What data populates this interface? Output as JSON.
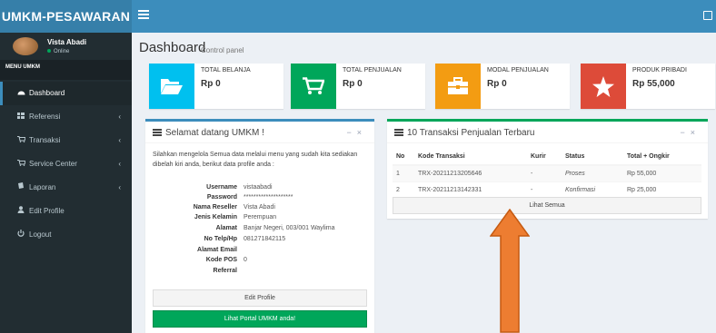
{
  "header": {
    "brand": "UMKM-PESAWARAN"
  },
  "sidebar": {
    "user": {
      "name": "Vista Abadi",
      "status": "Online"
    },
    "menu_header": "MENU UMKM",
    "items": [
      {
        "label": "Dashboard",
        "icon": "dashboard-icon",
        "active": true
      },
      {
        "label": "Referensi",
        "icon": "grid-icon",
        "has_children": true
      },
      {
        "label": "Transaksi",
        "icon": "cart-icon",
        "has_children": true
      },
      {
        "label": "Service Center",
        "icon": "cart-icon",
        "has_children": true
      },
      {
        "label": "Laporan",
        "icon": "book-icon",
        "has_children": true
      },
      {
        "label": "Edit Profile",
        "icon": "user-icon"
      },
      {
        "label": "Logout",
        "icon": "power-icon"
      }
    ]
  },
  "content": {
    "title": "Dashboard",
    "subtitle": "Control panel"
  },
  "info_boxes": [
    {
      "label": "TOTAL BELANJA",
      "value": "Rp 0",
      "color": "#00c0ef",
      "icon": "folder-icon"
    },
    {
      "label": "TOTAL PENJUALAN",
      "value": "Rp 0",
      "color": "#00a65a",
      "icon": "cart-icon"
    },
    {
      "label": "MODAL PENJUALAN",
      "value": "Rp 0",
      "color": "#f39c12",
      "icon": "briefcase-icon"
    },
    {
      "label": "PRODUK PRIBADI",
      "value": "Rp 55,000",
      "color": "#dd4b39",
      "icon": "star-icon"
    }
  ],
  "welcome": {
    "title": "Selamat datang UMKM !",
    "text": "Silahkan mengelola Semua data melalui menu yang sudah kita sediakan dibelah kiri anda, berikut data profile anda :",
    "fields": [
      {
        "key": "Username",
        "value": "vistaabadi"
      },
      {
        "key": "Password",
        "value": "********************"
      },
      {
        "key": "Nama Reseller",
        "value": "Vista Abadi"
      },
      {
        "key": "Jenis Kelamin",
        "value": "Perempuan"
      },
      {
        "key": "Alamat",
        "value": "Banjar Negeri, 003/001 Waylima"
      },
      {
        "key": "No Telp/Hp",
        "value": "081271842115"
      },
      {
        "key": "Alamat Email",
        "value": ""
      },
      {
        "key": "Kode POS",
        "value": "0"
      },
      {
        "key": "Referral",
        "value": ""
      }
    ],
    "edit_button": "Edit Profile",
    "portal_button": "Lihat Portal UMKM anda!"
  },
  "transactions": {
    "title": "10 Transaksi Penjualan Terbaru",
    "columns": [
      "No",
      "Kode Transaksi",
      "Kurir",
      "Status",
      "Total + Ongkir"
    ],
    "rows": [
      {
        "no": "1",
        "code": "TRX-20211213205646",
        "kurir": "-",
        "status": "Proses",
        "total": "Rp 55,000"
      },
      {
        "no": "2",
        "code": "TRX-20211213142331",
        "kurir": "-",
        "status": "Konfirmasi",
        "total": "Rp 25,000"
      }
    ],
    "view_all": "Lihat Semua"
  },
  "tools": {
    "minimize": "−",
    "close": "×"
  },
  "annotation": {
    "arrow_color": "#ed7d31"
  }
}
